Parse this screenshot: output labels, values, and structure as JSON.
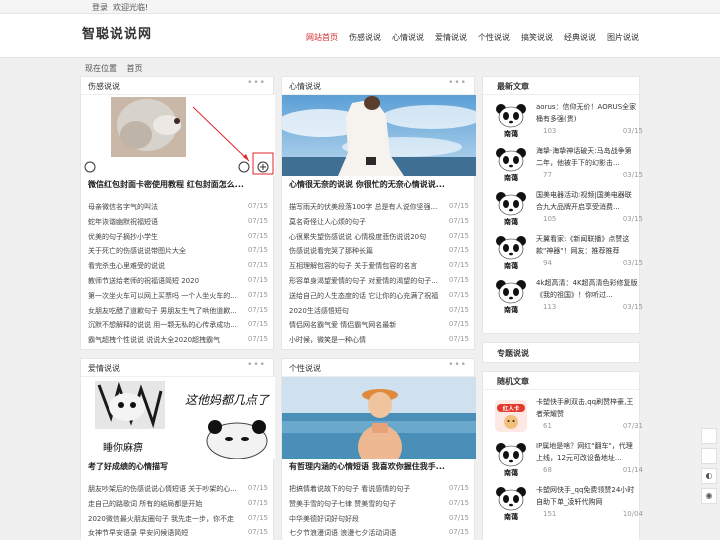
{
  "topbar": {
    "login": "登录",
    "welcome": "欢迎光临!"
  },
  "header": {
    "logo": "智聪说说网",
    "nav": [
      "网站首页",
      "伤感说说",
      "心情说说",
      "爱情说说",
      "个性说说",
      "搞笑说说",
      "经典说说",
      "图片说说"
    ]
  },
  "breadcrumb": {
    "label": "现在位置",
    "home": "首页"
  },
  "sections": [
    {
      "title": "伤感说说",
      "caption": "微信红包封面卡密使用教程 红包封面怎么...",
      "items": [
        {
          "text": "母亲微信名字气的叫法",
          "date": "07/15"
        },
        {
          "text": "蛇年诙谐幽默祝福短语",
          "date": "07/15"
        },
        {
          "text": "优美的句子摘抄小学生",
          "date": "07/15"
        },
        {
          "text": "关于死亡的伤感说说带图片大全",
          "date": "07/15"
        },
        {
          "text": "看完杀虫心里难受的说说",
          "date": "07/15"
        },
        {
          "text": "教师节送给老师的祝福语简短 2020",
          "date": "07/15"
        },
        {
          "text": "第一次坐火车可以网上买票吗 一个人坐火车的...",
          "date": "07/15"
        },
        {
          "text": "女朋友吃醋了道歉句子 男朋友生气了哄他道歉...",
          "date": "07/15"
        },
        {
          "text": "沉默不想解释的说说 用一颗无私的心传承成功...",
          "date": "07/15"
        },
        {
          "text": "霸气超拽个性说说 说说大全2020超拽霸气",
          "date": "07/15"
        }
      ]
    },
    {
      "title": "心情说说",
      "caption": "心情很无奈的说说 你很忙的无奈心情说说...",
      "items": [
        {
          "text": "描写雨天的伏美段落100字 总是有人说你坚强...",
          "date": "07/15"
        },
        {
          "text": "莫名奇怪让人心烦的句子",
          "date": "07/15"
        },
        {
          "text": "心很累失望伤感说说 心情极度悲伤说说20句",
          "date": "07/15"
        },
        {
          "text": "伤感说说看完哭了那种长篇",
          "date": "07/15"
        },
        {
          "text": "互相理解包容的句子 关于爱情包容的名言",
          "date": "07/15"
        },
        {
          "text": "形容单身渴望爱情的句子 对爱情的渴望的句子...",
          "date": "07/15"
        },
        {
          "text": "送给自己的人生态度的话 它让你的心充满了祝福...",
          "date": "07/15"
        },
        {
          "text": "2020生活感悟短句",
          "date": "07/15"
        },
        {
          "text": "情侣网名霸气爱 情侣霸气网名最新",
          "date": "07/15"
        },
        {
          "text": "小时候，微笑是一种心情",
          "date": "07/15"
        }
      ]
    },
    {
      "title": "爱情说说",
      "caption": "考了好成绩的心情描写",
      "picture_text": [
        "这他妈都几点了",
        "睡你麻痹"
      ],
      "items": [
        {
          "text": "朋友吵架后的伤感说说心情短语 关于吵架的心...",
          "date": "07/15"
        },
        {
          "text": "走自己的路歌词 所有的结局都是开始",
          "date": "07/15"
        },
        {
          "text": "2020微信最火朋友圈句子 我先走一步，你不走",
          "date": "07/15"
        },
        {
          "text": "女神节早安语录 早安问候语简短",
          "date": "07/15"
        }
      ]
    },
    {
      "title": "个性说说",
      "caption": "有哲理内涵的心情短语 我喜欢你握住我手...",
      "items": [
        {
          "text": "把搞情着说故下的句子 看说感情的句子",
          "date": "07/15"
        },
        {
          "text": "赞美手雪的句子七律 赞美雪的句子",
          "date": "07/15"
        },
        {
          "text": "中华美德好词好句好段",
          "date": "07/15"
        },
        {
          "text": "七夕节浪漫词语 浪漫七夕活动词语",
          "date": "07/15"
        }
      ]
    }
  ],
  "sidebar": {
    "latest_title": "最新文章",
    "latest": [
      {
        "title": "aorus：信仰无价！AORUS全家桶有多强(贵)",
        "count": "103",
        "date": "03/15"
      },
      {
        "title": "海挚·海挚神话破天:马岛战争第二年，他被手下的幻影击...",
        "count": "77",
        "date": "03/15"
      },
      {
        "title": "国美电器活动:视频|国美电器联合九大品牌开启享受消费...",
        "count": "105",
        "date": "03/15"
      },
      {
        "title": "天翼看家:《新闻联播》点赞这款\"神器\"！网友：推荐推荐",
        "count": "94",
        "date": "03/15"
      },
      {
        "title": "4k超高清：4K超高清色彩修复版《我的祖国》！你听过...",
        "count": "113",
        "date": "03/15"
      }
    ],
    "topics_title": "专题说说",
    "random_title": "随机文章",
    "random": [
      {
        "title": "卡塑快手刷双击,qq刷赞梓豪,王者荣耀赞",
        "count": "61",
        "date": "07/31"
      },
      {
        "title": "IP属地是啥？网红\"翻车\"，代理上线，12元可改设备地址...",
        "count": "68",
        "date": "01/14"
      },
      {
        "title": "卡塑网快手_qq免费领赞24小时自助下单_凌轩代购网",
        "count": "151",
        "date": "10/04"
      }
    ],
    "avatar_label": "南蔼",
    "badge_label": "红人卡"
  },
  "float_buttons": [
    "◐",
    "◉"
  ],
  "colors": {
    "accent": "#d9292e"
  }
}
